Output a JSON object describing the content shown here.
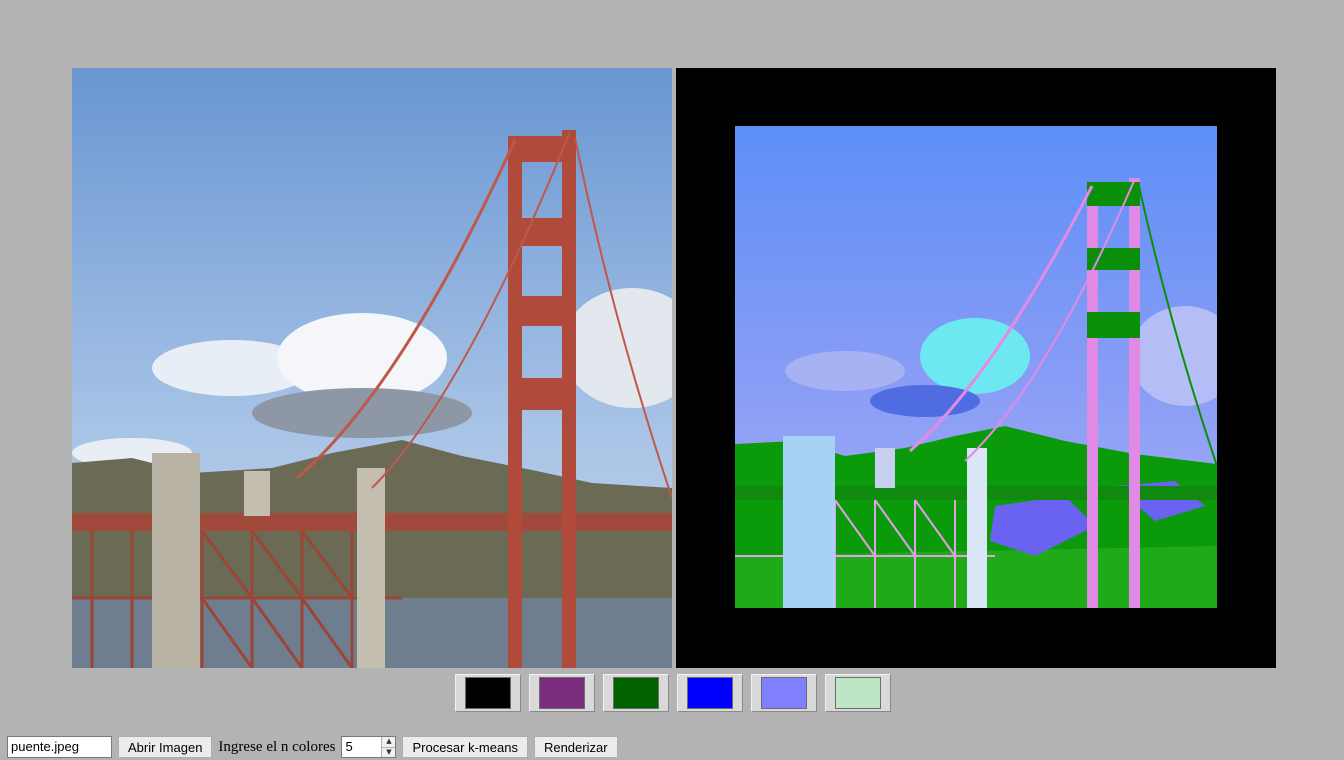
{
  "images": {
    "original": "puente.jpeg (original)",
    "processed": "k-means result"
  },
  "palette": [
    {
      "color": "#000000"
    },
    {
      "color": "#7a2d7e"
    },
    {
      "color": "#006300"
    },
    {
      "color": "#0000ff"
    },
    {
      "color": "#8080ff"
    },
    {
      "color": "#bfe6c4"
    }
  ],
  "controls": {
    "file_input_value": "puente.jpeg",
    "open_button": "Abrir Imagen",
    "colors_label": "Ingrese el n colores",
    "colors_value": "5",
    "spin_up": "▲",
    "spin_down": "▼",
    "process_button": "Procesar k-means",
    "render_button": "Renderizar"
  }
}
